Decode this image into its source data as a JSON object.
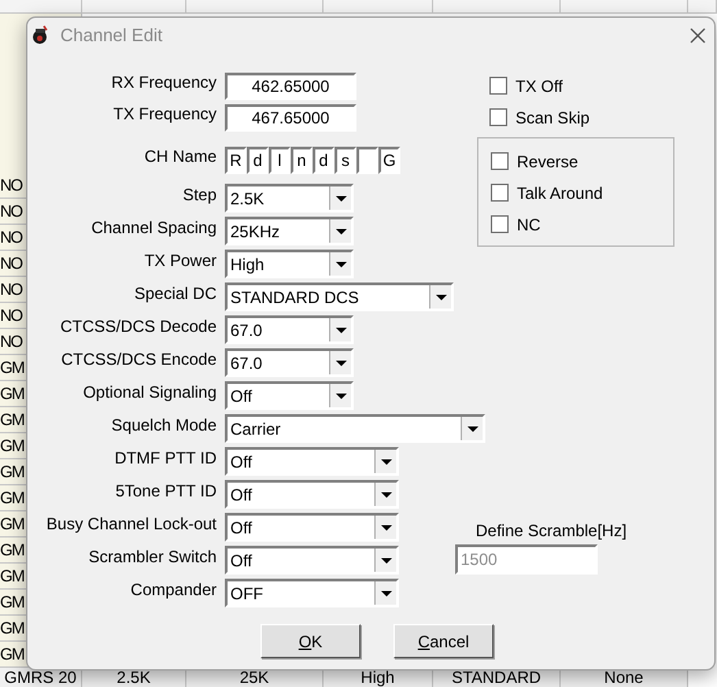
{
  "background_table": {
    "column_1": [
      "NO",
      "NO",
      "NO",
      "NO",
      "NO",
      "NO",
      "NO",
      "GM",
      "GM",
      "GM",
      "GM",
      "GM",
      "GM",
      "GM",
      "GM",
      "GM",
      "GM",
      "GM",
      "GM"
    ],
    "bottom_row": [
      "GMRS 20",
      "2.5K",
      "25K",
      "High",
      "STANDARD",
      "None"
    ]
  },
  "dialog": {
    "title": "Channel Edit",
    "fields": [
      {
        "kind": "text",
        "label": "RX Frequency",
        "value": "462.65000"
      },
      {
        "kind": "text",
        "label": "TX Frequency",
        "value": "467.65000"
      },
      {
        "kind": "chars",
        "label": "CH Name",
        "boxes": [
          {
            "kind": "letter",
            "char": "R"
          },
          {
            "kind": "letter",
            "char": "d"
          },
          {
            "kind": "letter",
            "char": "l"
          },
          {
            "kind": "letter",
            "char": "n"
          },
          {
            "kind": "letter",
            "char": "d"
          },
          {
            "kind": "letter",
            "char": "s"
          },
          {
            "kind": "blank"
          },
          {
            "kind": "letter",
            "char": "G"
          }
        ]
      },
      {
        "kind": "select",
        "label": "Step",
        "value": "2.5K"
      },
      {
        "kind": "select",
        "label": "Channel Spacing",
        "value": "25KHz"
      },
      {
        "kind": "select",
        "label": "TX Power",
        "value": "High"
      },
      {
        "kind": "select",
        "label": "Special DC",
        "value": "STANDARD DCS"
      },
      {
        "kind": "select",
        "label": "CTCSS/DCS Decode",
        "value": "67.0"
      },
      {
        "kind": "select",
        "label": "CTCSS/DCS Encode",
        "value": "67.0"
      },
      {
        "kind": "select",
        "label": "Optional Signaling",
        "value": "Off"
      },
      {
        "kind": "select",
        "label": "Squelch Mode",
        "value": "Carrier"
      },
      {
        "kind": "select",
        "label": "DTMF PTT ID",
        "value": "Off"
      },
      {
        "kind": "select",
        "label": "5Tone PTT ID",
        "value": "Off"
      },
      {
        "kind": "select",
        "label": "Busy Channel Lock-out",
        "value": "Off"
      },
      {
        "kind": "select",
        "label": "Scrambler Switch",
        "value": "Off"
      },
      {
        "kind": "select",
        "label": "Compander",
        "value": "OFF"
      }
    ],
    "options": [
      {
        "label": "TX Off",
        "checked": false
      },
      {
        "label": "Scan Skip",
        "checked": false
      }
    ],
    "group_options": [
      {
        "label": "Reverse",
        "checked": false
      },
      {
        "label": "Talk Around",
        "checked": false
      },
      {
        "label": "NC",
        "checked": false
      }
    ],
    "scramble": {
      "label": "Define Scramble[Hz]",
      "value": "1500",
      "disabled": true
    },
    "buttons": [
      "OK",
      "Cancel"
    ]
  }
}
